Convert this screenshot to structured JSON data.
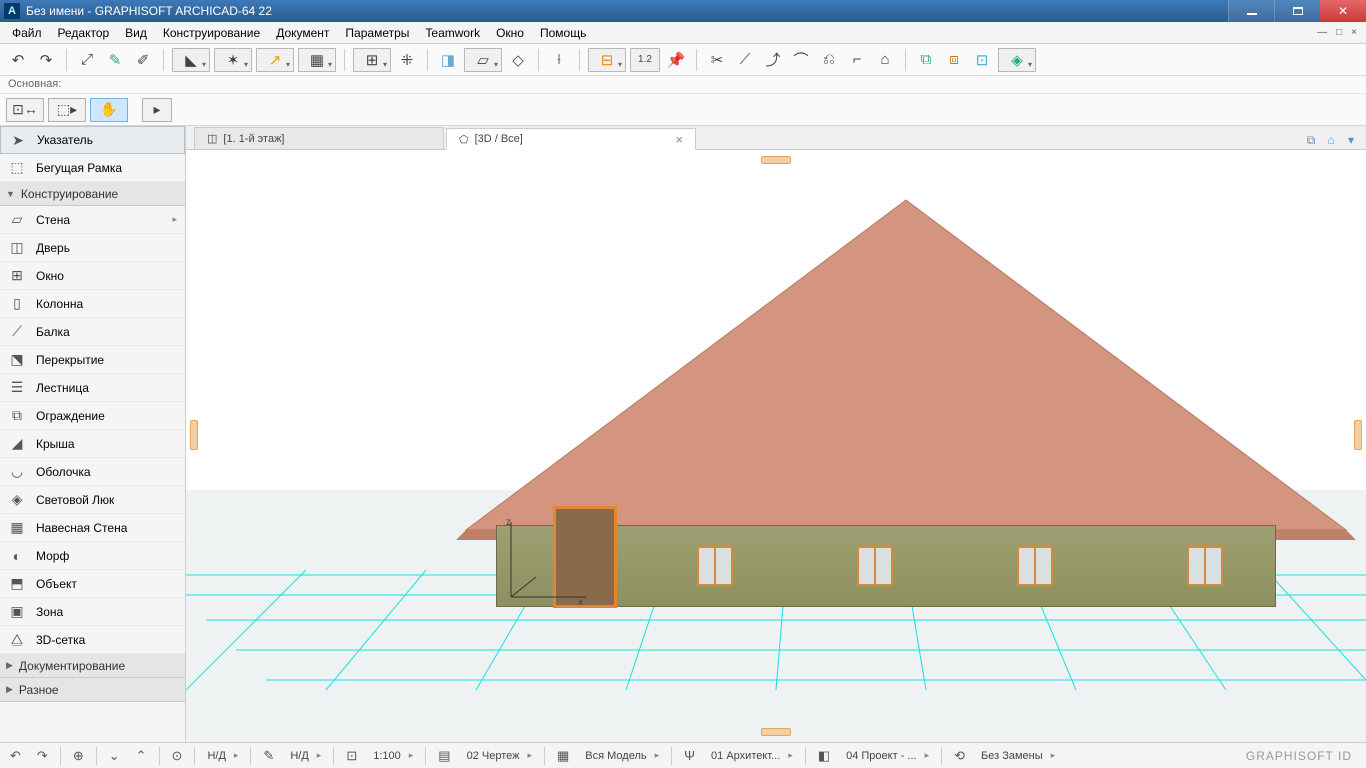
{
  "window": {
    "title": "Без имени - GRAPHISOFT ARCHICAD-64 22"
  },
  "menu": [
    "Файл",
    "Редактор",
    "Вид",
    "Конструирование",
    "Документ",
    "Параметры",
    "Teamwork",
    "Окно",
    "Помощь"
  ],
  "sub_label": "Основная:",
  "toolbox": {
    "pointer": "Указатель",
    "marquee": "Бегущая Рамка",
    "section_construct": "Конструирование",
    "items": [
      "Стена",
      "Дверь",
      "Окно",
      "Колонна",
      "Балка",
      "Перекрытие",
      "Лестница",
      "Ограждение",
      "Крыша",
      "Оболочка",
      "Световой Люк",
      "Навесная Стена",
      "Морф",
      "Объект",
      "Зона",
      "3D-сетка"
    ],
    "section_doc": "Документирование",
    "section_misc": "Разное"
  },
  "tabs": {
    "floor": "[1. 1-й этаж]",
    "view3d": "[3D / Все]"
  },
  "status": {
    "nd1": "Н/Д",
    "nd2": "Н/Д",
    "scale": "1:100",
    "layer": "02 Чертеж",
    "model": "Вся Модель",
    "arch": "01 Архитект...",
    "proj": "04 Проект - ...",
    "replace": "Без Замены",
    "brand": "GRAPHISOFT ID"
  }
}
